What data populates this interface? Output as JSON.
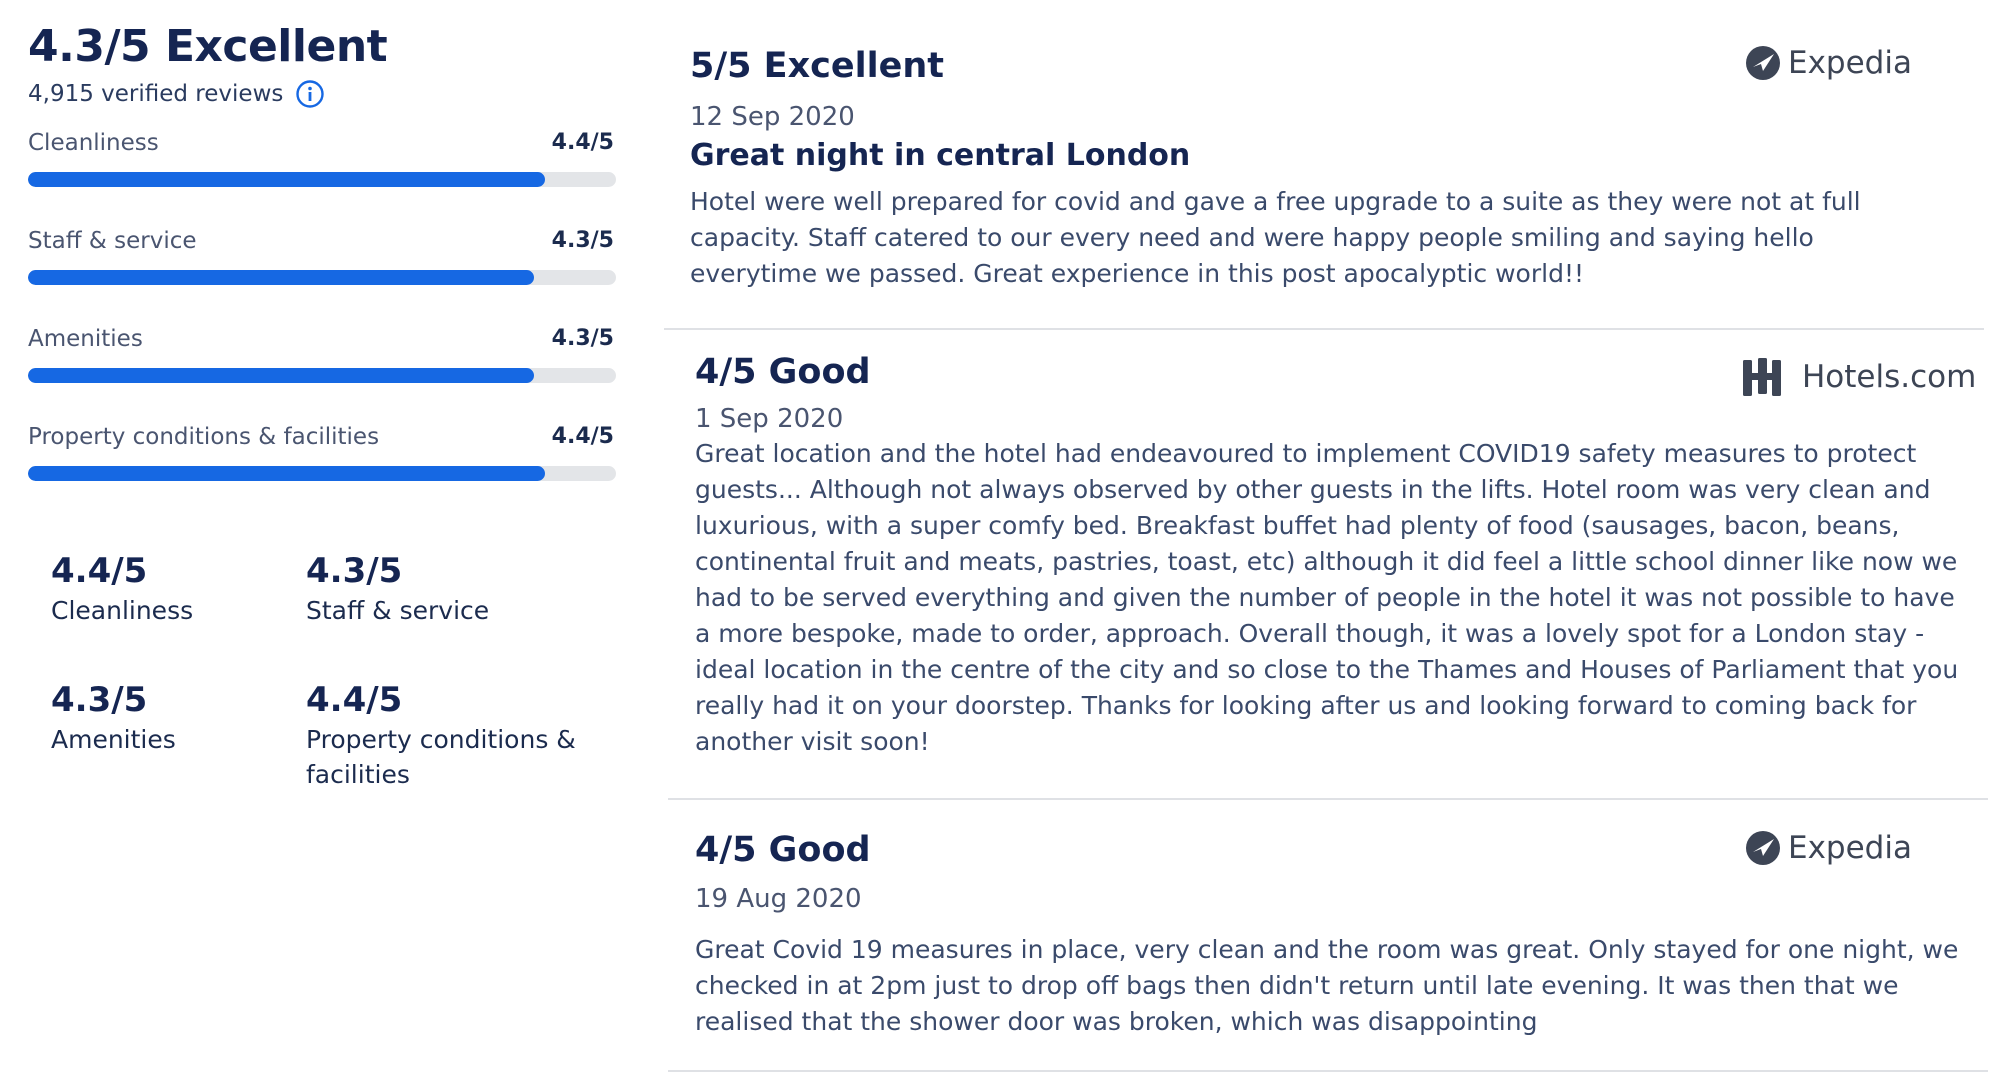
{
  "summary": {
    "overall": "4.3/5 Excellent",
    "verified_reviews": "4,915 verified reviews",
    "categories": [
      {
        "label": "Cleanliness",
        "score": "4.4/5",
        "fill": 0.88
      },
      {
        "label": "Staff & service",
        "score": "4.3/5",
        "fill": 0.86
      },
      {
        "label": "Amenities",
        "score": "4.3/5",
        "fill": 0.86
      },
      {
        "label": "Property conditions & facilities",
        "score": "4.4/5",
        "fill": 0.88
      }
    ],
    "grid": [
      {
        "score": "4.4/5",
        "label": "Cleanliness"
      },
      {
        "score": "4.3/5",
        "label": "Staff & service"
      },
      {
        "score": "4.3/5",
        "label": "Amenities"
      },
      {
        "score": "4.4/5",
        "label": "Property conditions & facilities"
      }
    ]
  },
  "reviews": [
    {
      "rating": "5/5 Excellent",
      "source": "Expedia",
      "date": "12 Sep 2020",
      "headline": "Great night in central London",
      "text": "Hotel were well prepared for covid and gave a free upgrade to a suite as they were not at full capacity. Staff catered to our every need and were happy people smiling and saying hello everytime we passed. Great experience in this post apocalyptic world!!"
    },
    {
      "rating": "4/5 Good",
      "source": "Hotels.com",
      "date": "1 Sep 2020",
      "headline": "",
      "text": "Great location and the hotel had endeavoured to implement COVID19 safety measures to protect guests... Although not always observed by other guests in the lifts. Hotel room was very clean and luxurious, with a super comfy bed. Breakfast buffet had plenty of food (sausages, bacon, beans, continental fruit and meats, pastries, toast, etc) although it did feel a little school dinner like now we had to be served everything and given the number of people in the hotel it was not possible to have a more bespoke, made to order, approach. Overall though, it was a lovely spot for a London stay - ideal location in the centre of the city and so close to the Thames and Houses of Parliament that you really had it on your doorstep. Thanks for looking after us and looking forward to coming back for another visit soon!"
    },
    {
      "rating": "4/5 Good",
      "source": "Expedia",
      "date": "19 Aug 2020",
      "headline": "",
      "text": "Great Covid 19 measures in place, very clean and the room was great. Only stayed for one night, we checked in at 2pm just to drop off bags then didn't return until late evening. It was then that we realised that the shower door was broken, which was disappointing"
    }
  ],
  "colors": {
    "accent": "#1668e3",
    "title": "#152552",
    "track": "#e3e5e8"
  },
  "icons": [
    "info-icon",
    "expedia-logo-icon",
    "hotels-com-logo-icon"
  ]
}
